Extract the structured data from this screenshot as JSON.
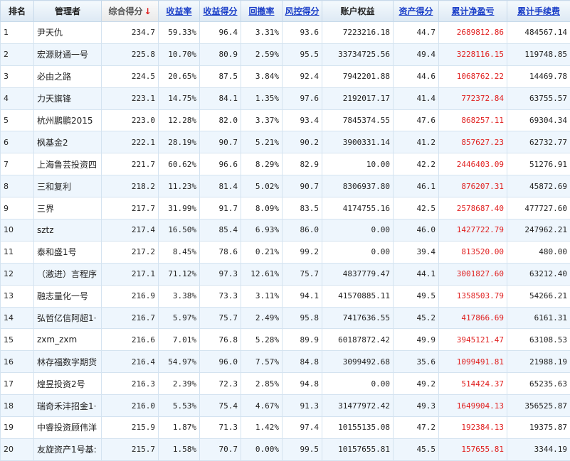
{
  "headers": [
    {
      "label": "排名",
      "style": "plain"
    },
    {
      "label": "管理者",
      "style": "plain"
    },
    {
      "label": "综合得分",
      "style": "sorted"
    },
    {
      "label": "收益率",
      "style": "link"
    },
    {
      "label": "收益得分",
      "style": "link"
    },
    {
      "label": "回撤率",
      "style": "link"
    },
    {
      "label": "风控得分",
      "style": "link"
    },
    {
      "label": "账户权益",
      "style": "plain"
    },
    {
      "label": "资产得分",
      "style": "link"
    },
    {
      "label": "累计净盈亏",
      "style": "link"
    },
    {
      "label": "累计手续费",
      "style": "link"
    }
  ],
  "sort_icon": "arrow-down-icon",
  "accent_red": "#e02020",
  "rows": [
    [
      "1",
      "尹天仇",
      "234.7",
      "59.33%",
      "96.4",
      "3.31%",
      "93.6",
      "7223216.18",
      "44.7",
      "2689812.86",
      "484567.14"
    ],
    [
      "2",
      "宏源财通一号",
      "225.8",
      "10.70%",
      "80.9",
      "2.59%",
      "95.5",
      "33734725.56",
      "49.4",
      "3228116.15",
      "119748.85"
    ],
    [
      "3",
      "必由之路",
      "224.5",
      "20.65%",
      "87.5",
      "3.84%",
      "92.4",
      "7942201.88",
      "44.6",
      "1068762.22",
      "14469.78"
    ],
    [
      "4",
      "力天旗锋",
      "223.1",
      "14.75%",
      "84.1",
      "1.35%",
      "97.6",
      "2192017.17",
      "41.4",
      "772372.84",
      "63755.57"
    ],
    [
      "5",
      "杭州鹏鹏2015",
      "223.0",
      "12.28%",
      "82.0",
      "3.37%",
      "93.4",
      "7845374.55",
      "47.6",
      "868257.11",
      "69304.34"
    ],
    [
      "6",
      "枫基金2",
      "222.1",
      "28.19%",
      "90.7",
      "5.21%",
      "90.2",
      "3900331.14",
      "41.2",
      "857627.23",
      "62732.77"
    ],
    [
      "7",
      "上海鲁芸投资四",
      "221.7",
      "60.62%",
      "96.6",
      "8.29%",
      "82.9",
      "10.00",
      "42.2",
      "2446403.09",
      "51276.91"
    ],
    [
      "8",
      "三和复利",
      "218.2",
      "11.23%",
      "81.4",
      "5.02%",
      "90.7",
      "8306937.80",
      "46.1",
      "876207.31",
      "45872.69"
    ],
    [
      "9",
      "三界",
      "217.7",
      "31.99%",
      "91.7",
      "8.09%",
      "83.5",
      "4174755.16",
      "42.5",
      "2578687.40",
      "477727.60"
    ],
    [
      "10",
      "sztz",
      "217.4",
      "16.50%",
      "85.4",
      "6.93%",
      "86.0",
      "0.00",
      "46.0",
      "1427722.79",
      "247962.21"
    ],
    [
      "11",
      "泰和盛1号",
      "217.2",
      "8.45%",
      "78.6",
      "0.21%",
      "99.2",
      "0.00",
      "39.4",
      "813520.00",
      "480.00"
    ],
    [
      "12",
      "（激进）言程序",
      "217.1",
      "71.12%",
      "97.3",
      "12.61%",
      "75.7",
      "4837779.47",
      "44.1",
      "3001827.60",
      "63212.40"
    ],
    [
      "13",
      "融志量化一号",
      "216.9",
      "3.38%",
      "73.3",
      "3.11%",
      "94.1",
      "41570885.11",
      "49.5",
      "1358503.79",
      "54266.21"
    ],
    [
      "14",
      "弘哲亿信阿超1·",
      "216.7",
      "5.97%",
      "75.7",
      "2.49%",
      "95.8",
      "7417636.55",
      "45.2",
      "417866.69",
      "6161.31"
    ],
    [
      "15",
      "zxm_zxm",
      "216.6",
      "7.01%",
      "76.8",
      "5.28%",
      "89.9",
      "60187872.42",
      "49.9",
      "3945121.47",
      "63108.53"
    ],
    [
      "16",
      "林存福数字期货",
      "216.4",
      "54.97%",
      "96.0",
      "7.57%",
      "84.8",
      "3099492.68",
      "35.6",
      "1099491.81",
      "21988.19"
    ],
    [
      "17",
      "煌昱投资2号",
      "216.3",
      "2.39%",
      "72.3",
      "2.85%",
      "94.8",
      "0.00",
      "49.2",
      "514424.37",
      "65235.63"
    ],
    [
      "18",
      "瑞奇禾沣招金1·",
      "216.0",
      "5.53%",
      "75.4",
      "4.67%",
      "91.3",
      "31477972.42",
      "49.3",
      "1649904.13",
      "356525.87"
    ],
    [
      "19",
      "中睿投资顾伟洋",
      "215.9",
      "1.87%",
      "71.3",
      "1.42%",
      "97.4",
      "10155135.08",
      "47.2",
      "192384.13",
      "19375.87"
    ],
    [
      "20",
      "友旋资产1号基:",
      "215.7",
      "1.58%",
      "70.7",
      "0.00%",
      "99.5",
      "10157655.81",
      "45.5",
      "157655.81",
      "3344.19"
    ]
  ]
}
